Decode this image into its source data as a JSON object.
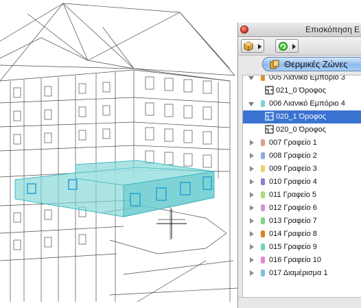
{
  "palette": {
    "title": "Επισκόπηση Ε",
    "tab_label": "Θερμικές Ζώνες"
  },
  "colors": {
    "selection": "#3a73d1",
    "zone_highlight": "#7fd6d6",
    "tab_blue": "#8fbbee"
  },
  "tree": [
    {
      "label": "005 Λιανικό Εμπόριο 3",
      "kind": "zone",
      "expanded": true,
      "swatch": "#e0902a"
    },
    {
      "label": "021_0 Όροφος",
      "kind": "story"
    },
    {
      "label": "006 Λιανικό Εμπόριο 4",
      "kind": "zone",
      "expanded": true,
      "swatch": "#7fd6d6"
    },
    {
      "label": "020_1 Όροφος",
      "kind": "story",
      "selected": true
    },
    {
      "label": "020_0 Όροφος",
      "kind": "story"
    },
    {
      "label": "007 Γραφείο 1",
      "kind": "zone",
      "expanded": false,
      "swatch": "#d9a08c"
    },
    {
      "label": "008 Γραφείο 2",
      "kind": "zone",
      "expanded": false,
      "swatch": "#8ea9dc"
    },
    {
      "label": "009 Γραφείο 3",
      "kind": "zone",
      "expanded": false,
      "swatch": "#e6d36a"
    },
    {
      "label": "010 Γραφείο 4",
      "kind": "zone",
      "expanded": false,
      "swatch": "#8a7ed4"
    },
    {
      "label": "011 Γραφείο 5",
      "kind": "zone",
      "expanded": false,
      "swatch": "#a7dc74"
    },
    {
      "label": "012 Γραφείο 6",
      "kind": "zone",
      "expanded": false,
      "swatch": "#d98fd6"
    },
    {
      "label": "013 Γραφείο 7",
      "kind": "zone",
      "expanded": false,
      "swatch": "#7ed488"
    },
    {
      "label": "014 Γραφείο 8",
      "kind": "zone",
      "expanded": false,
      "swatch": "#e07f1e"
    },
    {
      "label": "015 Γραφείο 9",
      "kind": "zone",
      "expanded": false,
      "swatch": "#6ad6b4"
    },
    {
      "label": "016 Γραφείο 10",
      "kind": "zone",
      "expanded": false,
      "swatch": "#e08ad0"
    },
    {
      "label": "017 Διαμέρισμα 1",
      "kind": "zone",
      "expanded": false,
      "swatch": "#7fc0dc"
    }
  ]
}
